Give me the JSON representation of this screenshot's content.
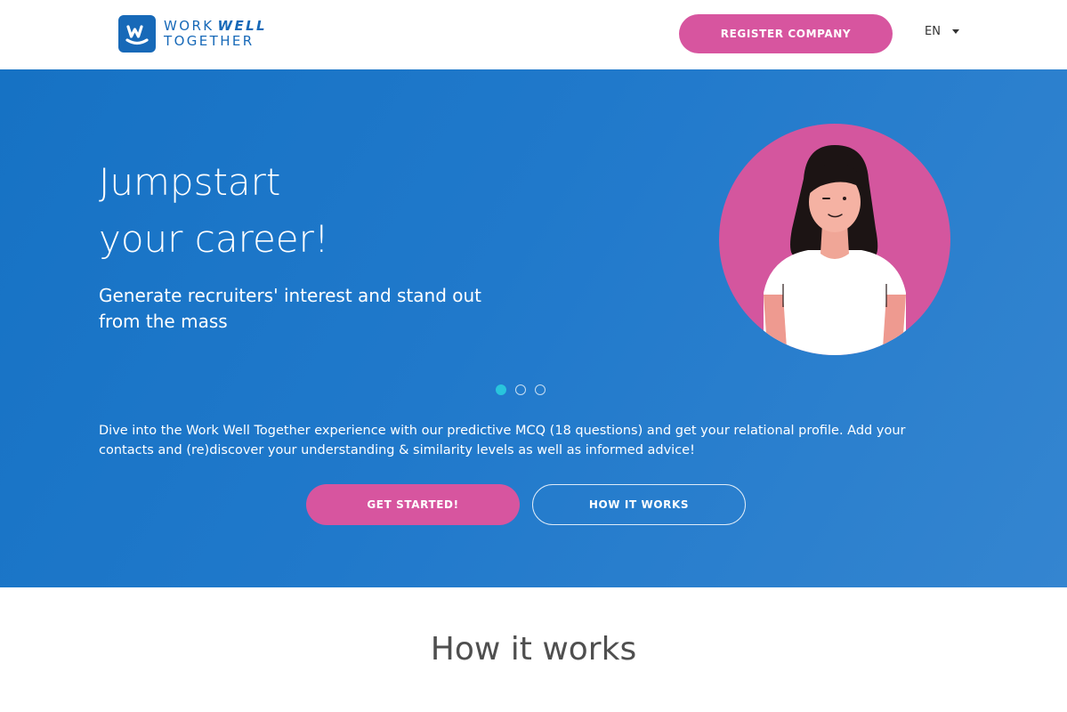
{
  "header": {
    "logo": {
      "line1_light": "WORK",
      "line1_bold": "WELL",
      "line2": "TOGETHER",
      "brand_color": "#1769b8",
      "icon": "ww-logo-icon"
    },
    "register_label": "REGISTER COMPANY",
    "language": {
      "selected": "EN",
      "icon": "caret-down-icon"
    }
  },
  "hero": {
    "title_line1": "Jumpstart",
    "title_line2": "your career!",
    "subtitle": "Generate recruiters' interest and stand out from the mass",
    "illustration": "woman-avatar-illustration",
    "carousel": {
      "slide_count": 3,
      "active_index": 0
    },
    "description": "Dive into the Work Well Together experience with our predictive MCQ (18 questions) and get your relational profile. Add your contacts and (re)discover your understanding & similarity levels as well as informed advice!",
    "primary_button": "GET STARTED!",
    "secondary_button": "HOW IT WORKS"
  },
  "how_it_works": {
    "title": "How it works"
  },
  "colors": {
    "accent_pink": "#d7559f",
    "hero_blue": "#1a74c6",
    "carousel_active": "#29c5dc"
  }
}
